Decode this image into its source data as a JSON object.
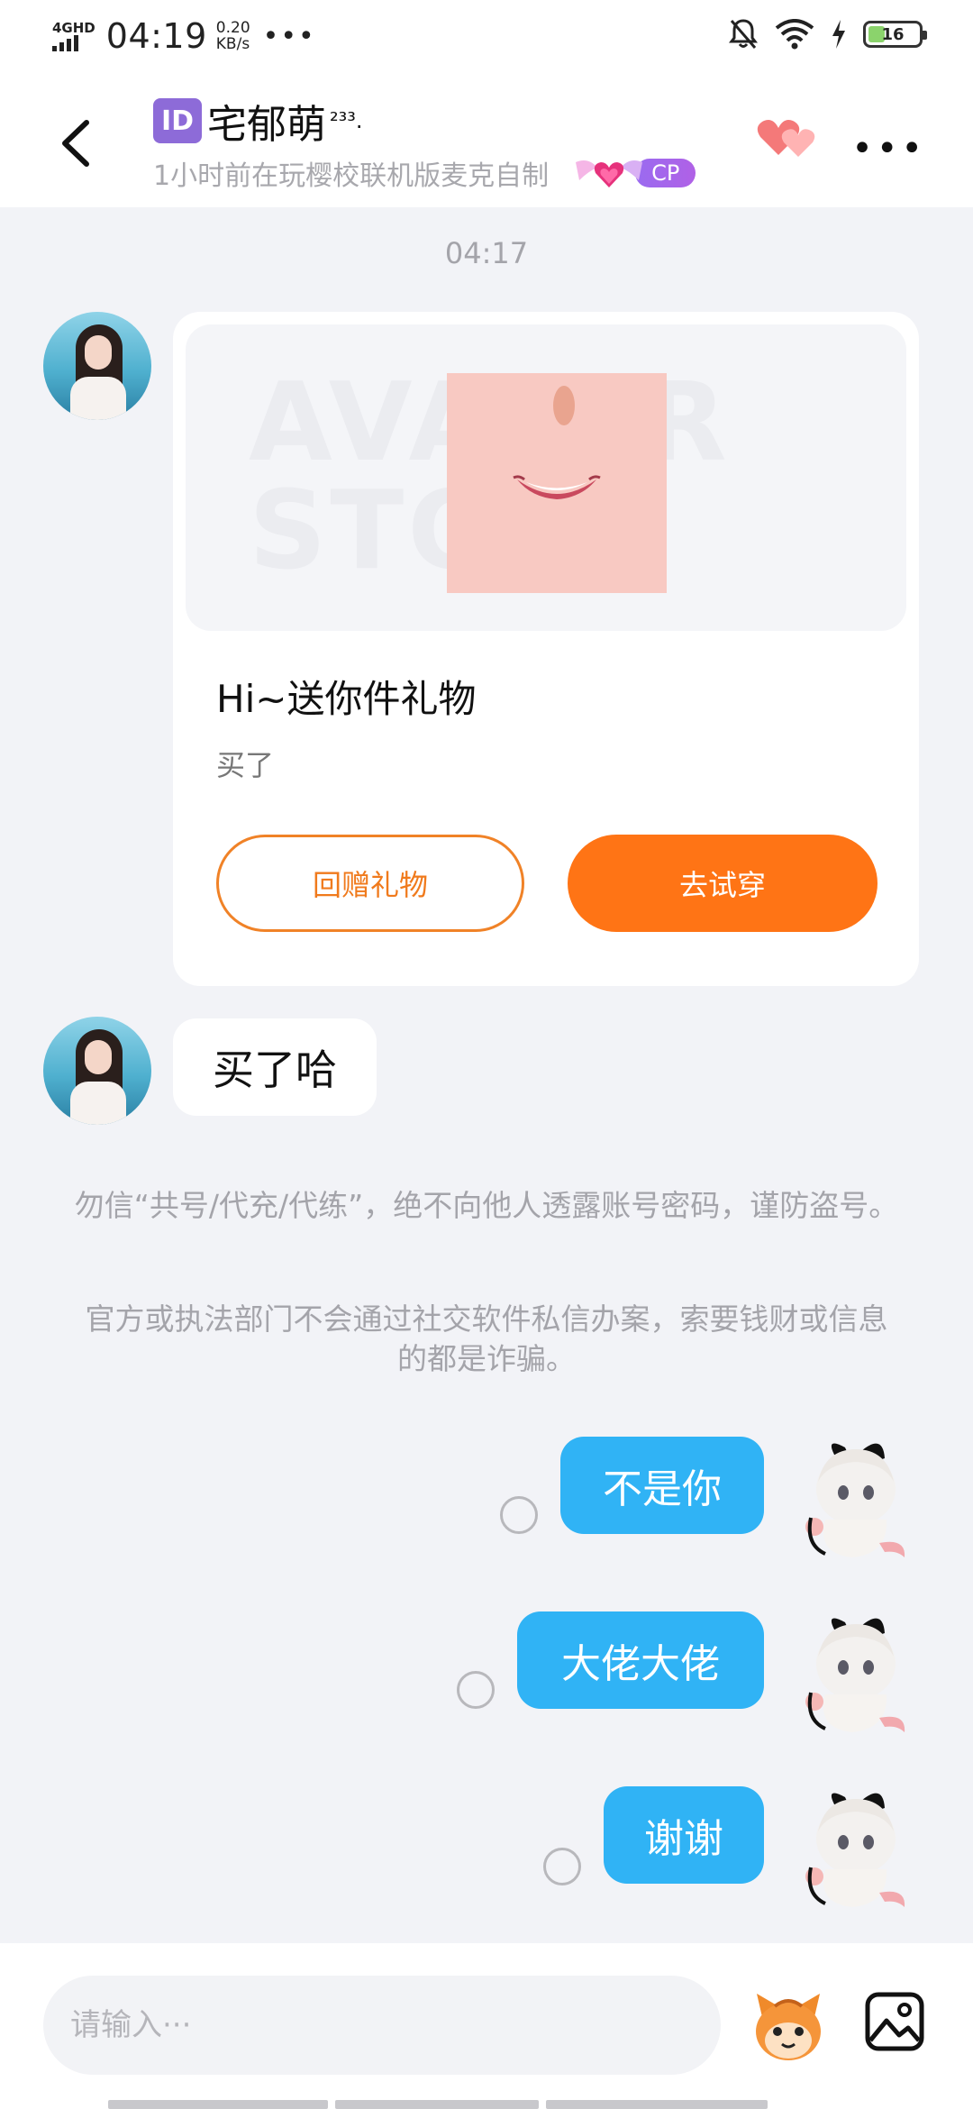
{
  "status_bar": {
    "network": "4GHD",
    "time": "04:19",
    "speed_value": "0.20",
    "speed_unit": "KB/s",
    "more": "•••",
    "battery": "16"
  },
  "header": {
    "id_badge": "ID",
    "title": "宅郁萌",
    "title_suffix": "²³³.",
    "subtitle": "1小时前在玩樱校联机版麦克自制",
    "cp_label": "CP",
    "more": "•••"
  },
  "chat": {
    "timestamp": "04:17",
    "gift_card": {
      "watermark": "AVATAR STORE",
      "title": "Hi~送你件礼物",
      "description": "买了",
      "return_gift_label": "回赠礼物",
      "try_on_label": "去试穿"
    },
    "incoming_message": "买了哈",
    "notice_1": "勿信“共号/代充/代练”，绝不向他人透露账号密码，谨防盗号。",
    "notice_2": "官方或执法部门不会通过社交软件私信办案，索要钱财或信息的都是诈骗。",
    "outgoing_messages": [
      "不是你",
      "大佬大佬",
      "谢谢"
    ]
  },
  "input": {
    "placeholder": "请输入···"
  },
  "colors": {
    "accent_orange": "#ff7415",
    "outgoing_bubble": "#30b3f5",
    "cp_purple": "#9a6bf0"
  }
}
